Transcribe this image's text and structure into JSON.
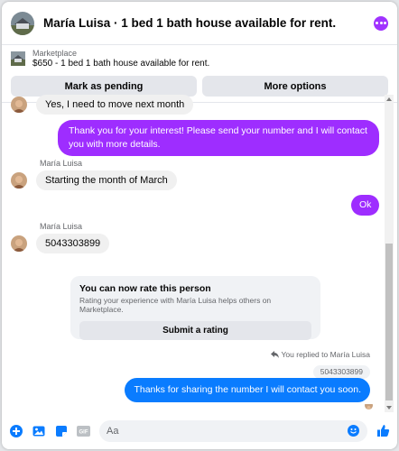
{
  "header": {
    "title": "María Luisa · 1 bed 1 bath house available for rent."
  },
  "listing": {
    "source": "Marketplace",
    "title": "$650 - 1 bed 1 bath house available for rent."
  },
  "actions": {
    "mark_pending": "Mark as pending",
    "more_options": "More options"
  },
  "messages": {
    "m1": "Yes, I need to move next month",
    "m2": "Thank you for your interest! Please send your number and I will contact you with more details.",
    "m3_sender": "María Luisa",
    "m3": "Starting the month of March",
    "m4": "Ok",
    "m5_sender": "María Luisa",
    "m5": "5043303899"
  },
  "rating": {
    "title": "You can now rate this person",
    "subtitle": "Rating your experience with María Luisa helps others on Marketplace.",
    "button": "Submit a rating"
  },
  "reply": {
    "note": "You replied to María Luisa",
    "quoted": "5043303899",
    "message": "Thanks for sharing the number I will contact you soon."
  },
  "composer": {
    "placeholder": "Aa"
  },
  "colors": {
    "accent_purple": "#9e2dff",
    "accent_blue": "#0a7cff",
    "icon_blue": "#0a7cff"
  },
  "icons": [
    "more-icon",
    "add-icon",
    "image-icon",
    "sticker-icon",
    "gif-icon",
    "emoji-icon",
    "thumbs-up-icon",
    "reply-arrow-icon"
  ]
}
